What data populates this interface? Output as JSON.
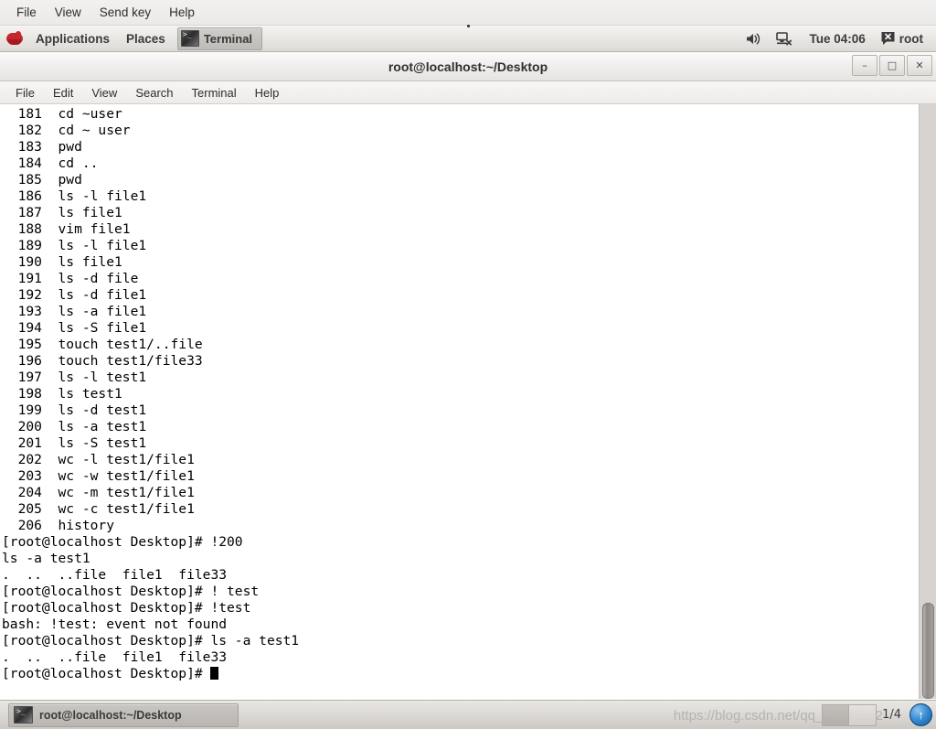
{
  "viewer_menu": {
    "items": [
      {
        "name": "file",
        "label": "File"
      },
      {
        "name": "view",
        "label": "View"
      },
      {
        "name": "send-key",
        "label": "Send key"
      },
      {
        "name": "help",
        "label": "Help"
      }
    ]
  },
  "gnome_panel": {
    "logo_name": "redhat-logo",
    "applications_label": "Applications",
    "places_label": "Places",
    "window_button_label": "Terminal",
    "volume_icon": "volume-icon",
    "network_icon": "network-disconnected-icon",
    "clock": "Tue 04:06",
    "user_icon": "user-account-icon",
    "username": "root"
  },
  "terminal_window": {
    "title": "root@localhost:~/Desktop",
    "controls": {
      "minimize": "–",
      "maximize": "□",
      "close": "✕"
    },
    "menu": [
      {
        "name": "file",
        "label": "File"
      },
      {
        "name": "edit",
        "label": "Edit"
      },
      {
        "name": "view",
        "label": "View"
      },
      {
        "name": "search",
        "label": "Search"
      },
      {
        "name": "terminal",
        "label": "Terminal"
      },
      {
        "name": "help",
        "label": "Help"
      }
    ],
    "lines": [
      "  181  cd ~user",
      "  182  cd ~ user",
      "  183  pwd",
      "  184  cd ..",
      "  185  pwd",
      "  186  ls -l file1",
      "  187  ls file1",
      "  188  vim file1",
      "  189  ls -l file1",
      "  190  ls file1",
      "  191  ls -d file",
      "  192  ls -d file1",
      "  193  ls -a file1",
      "  194  ls -S file1",
      "  195  touch test1/..file",
      "  196  touch test1/file33",
      "  197  ls -l test1",
      "  198  ls test1",
      "  199  ls -d test1",
      "  200  ls -a test1",
      "  201  ls -S test1",
      "  202  wc -l test1/file1",
      "  203  wc -w test1/file1",
      "  204  wc -m test1/file1",
      "  205  wc -c test1/file1",
      "  206  history",
      "[root@localhost Desktop]# !200",
      "ls -a test1",
      ".  ..  ..file  file1  file33",
      "[root@localhost Desktop]# ! test",
      "[root@localhost Desktop]# !test",
      "bash: !test: event not found",
      "[root@localhost Desktop]# ls -a test1",
      ".  ..  ..file  file1  file33"
    ],
    "prompt_line": "[root@localhost Desktop]# "
  },
  "taskbar": {
    "task_button_label": "root@localhost:~/Desktop",
    "task_button_icon": "terminal-icon",
    "workspace_label": "1/4",
    "orb_label": "↑",
    "watermark": "https://blog.csdn.net/qq_41193522"
  }
}
